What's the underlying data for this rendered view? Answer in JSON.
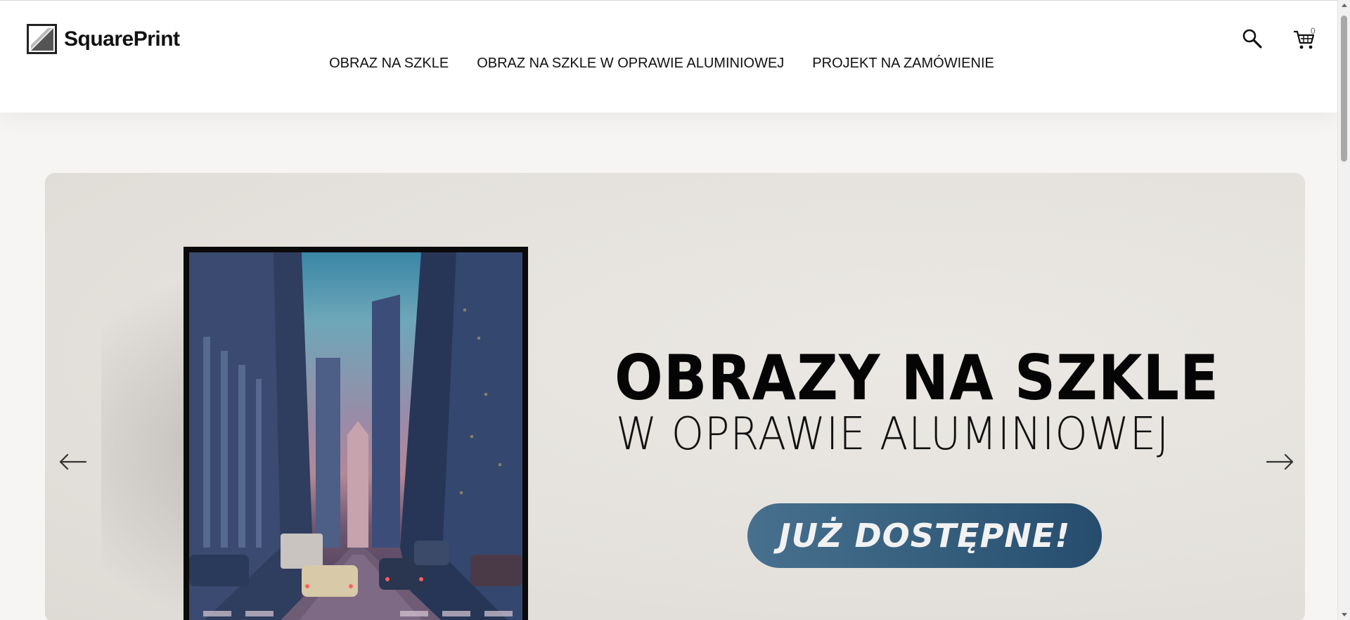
{
  "brand": {
    "name": "SquarePrint"
  },
  "nav": {
    "items": [
      {
        "label": "OBRAZ NA SZKLE"
      },
      {
        "label": "OBRAZ NA SZKLE W OPRAWIE ALUMINIOWEJ"
      },
      {
        "label": "PROJEKT NA ZAMÓWIENIE"
      }
    ]
  },
  "header": {
    "search_icon": "search-icon",
    "cart_icon": "cart-icon",
    "cart_count": "0"
  },
  "hero": {
    "title": "OBRAZY NA SZKLE",
    "subtitle": "W OPRAWIE ALUMINIOWEJ",
    "cta_label": "JUŻ DOSTĘPNE!",
    "prev_icon": "arrow-left-icon",
    "next_icon": "arrow-right-icon",
    "cta_color_start": "#47708f",
    "cta_color_end": "#264c6e"
  }
}
